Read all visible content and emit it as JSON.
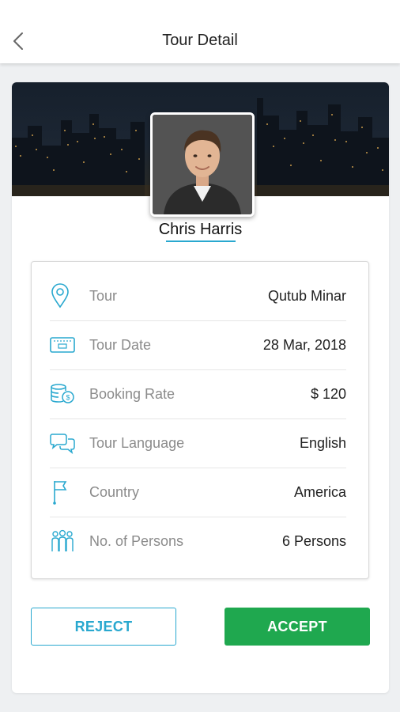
{
  "header": {
    "title": "Tour Detail",
    "back_icon": "chevron-left-icon"
  },
  "profile": {
    "name": "Chris Harris"
  },
  "details": [
    {
      "icon": "map-pin-icon",
      "label": "Tour",
      "value": "Qutub Minar"
    },
    {
      "icon": "ticket-icon",
      "label": "Tour Date",
      "value": "28 Mar, 2018"
    },
    {
      "icon": "coins-icon",
      "label": "Booking Rate",
      "value": "$ 120"
    },
    {
      "icon": "chat-bubbles-icon",
      "label": "Tour Language",
      "value": "English"
    },
    {
      "icon": "flag-icon",
      "label": "Country",
      "value": "America"
    },
    {
      "icon": "people-icon",
      "label": "No. of Persons",
      "value": "6 Persons"
    }
  ],
  "actions": {
    "reject_label": "REJECT",
    "accept_label": "ACCEPT"
  },
  "colors": {
    "accent": "#29a8cf",
    "accept": "#1fa84f",
    "background": "#eef0f2"
  }
}
